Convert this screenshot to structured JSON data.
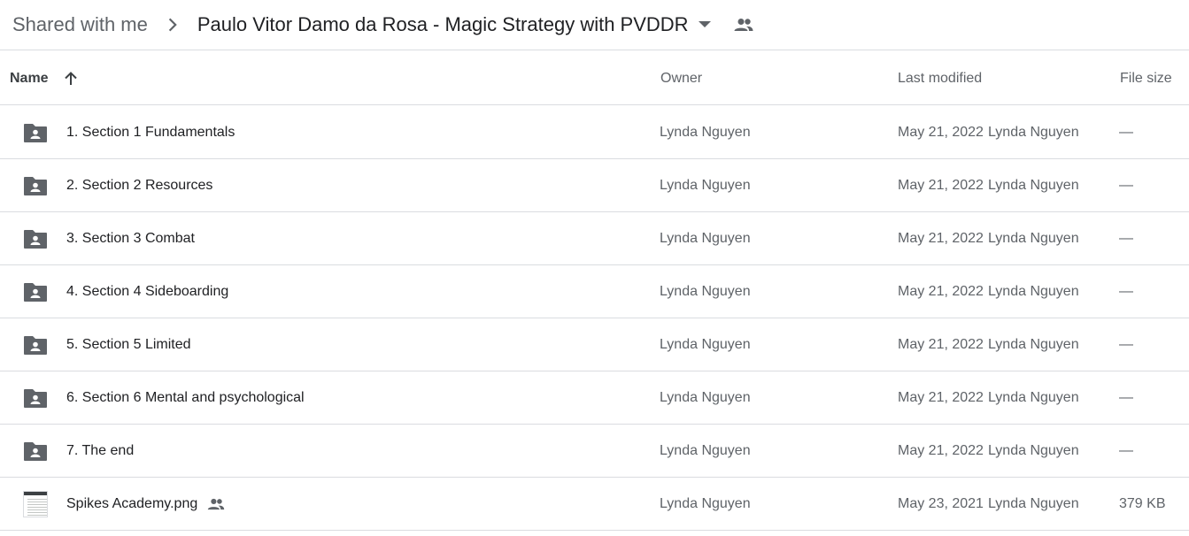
{
  "breadcrumb": {
    "root": "Shared with me",
    "current": "Paulo Vitor Damo da Rosa - Magic Strategy with PVDDR"
  },
  "columns": {
    "name": "Name",
    "owner": "Owner",
    "last_modified": "Last modified",
    "file_size": "File size"
  },
  "rows": [
    {
      "name": "1. Section 1 Fundamentals",
      "owner": "Lynda Nguyen",
      "date": "May 21, 2022",
      "modifier": "Lynda Nguyen",
      "size": "—",
      "icon": "shared-folder-icon"
    },
    {
      "name": "2. Section 2 Resources",
      "owner": "Lynda Nguyen",
      "date": "May 21, 2022",
      "modifier": "Lynda Nguyen",
      "size": "—",
      "icon": "shared-folder-icon"
    },
    {
      "name": "3. Section 3 Combat",
      "owner": "Lynda Nguyen",
      "date": "May 21, 2022",
      "modifier": "Lynda Nguyen",
      "size": "—",
      "icon": "shared-folder-icon"
    },
    {
      "name": "4. Section 4 Sideboarding",
      "owner": "Lynda Nguyen",
      "date": "May 21, 2022",
      "modifier": "Lynda Nguyen",
      "size": "—",
      "icon": "shared-folder-icon"
    },
    {
      "name": "5. Section 5 Limited",
      "owner": "Lynda Nguyen",
      "date": "May 21, 2022",
      "modifier": "Lynda Nguyen",
      "size": "—",
      "icon": "shared-folder-icon"
    },
    {
      "name": "6. Section 6 Mental and psychological",
      "owner": "Lynda Nguyen",
      "date": "May 21, 2022",
      "modifier": "Lynda Nguyen",
      "size": "—",
      "icon": "shared-folder-icon"
    },
    {
      "name": "7. The end",
      "owner": "Lynda Nguyen",
      "date": "May 21, 2022",
      "modifier": "Lynda Nguyen",
      "size": "—",
      "icon": "shared-folder-icon"
    },
    {
      "name": "Spikes Academy.png",
      "owner": "Lynda Nguyen",
      "date": "May 23, 2021",
      "modifier": "Lynda Nguyen",
      "size": "379 KB",
      "icon": "image-thumbnail-icon",
      "shared": true
    }
  ],
  "icons": {
    "breadcrumb_separator": "chevron-right-icon",
    "dropdown": "caret-down-icon",
    "shared": "people-icon",
    "sort": "arrow-up-icon"
  },
  "colors": {
    "icon_gray": "#5f6368",
    "divider": "#dadce0",
    "text_primary": "#202124",
    "text_secondary": "#5f6368"
  }
}
